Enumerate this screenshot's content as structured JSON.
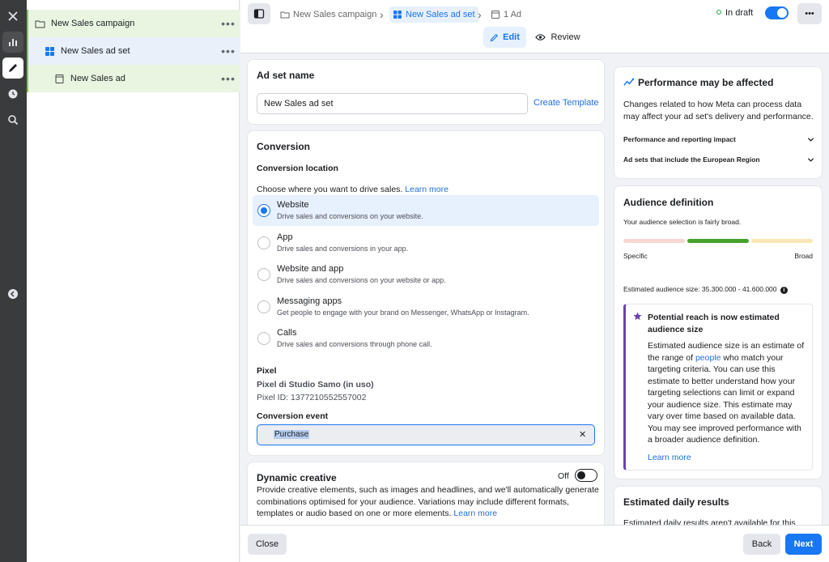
{
  "tree": {
    "campaign": "New Sales campaign",
    "adset": "New Sales ad set",
    "ad": "New Sales ad",
    "more": "•••"
  },
  "breadcrumb": {
    "campaign": "New Sales campaign",
    "adset": "New Sales ad set",
    "ad": "1 Ad",
    "separator": "›"
  },
  "header": {
    "status": "In draft",
    "more": "•••",
    "edit": "Edit",
    "review": "Review",
    "toggle_on": true
  },
  "adset_name": {
    "title": "Ad set name",
    "value": "New Sales ad set",
    "create_template": "Create Template"
  },
  "conversion": {
    "title": "Conversion",
    "location_label": "Conversion location",
    "prompt": "Choose where you want to drive sales.",
    "learn_more": "Learn more",
    "options": [
      {
        "title": "Website",
        "desc": "Drive sales and conversions on your website.",
        "selected": true
      },
      {
        "title": "App",
        "desc": "Drive sales and conversions in your app.",
        "selected": false
      },
      {
        "title": "Website and app",
        "desc": "Drive sales and conversions on your website or app.",
        "selected": false
      },
      {
        "title": "Messaging apps",
        "desc": "Get people to engage with your brand on Messenger, WhatsApp or Instagram.",
        "selected": false
      },
      {
        "title": "Calls",
        "desc": "Drive sales and conversions through phone call.",
        "selected": false
      }
    ],
    "pixel_label": "Pixel",
    "pixel_name": "Pixel di Studio Samo (in uso)",
    "pixel_id": "Pixel ID: 1377210552557002",
    "event_label": "Conversion event",
    "event_value": "Purchase",
    "clear": "✕"
  },
  "dynamic": {
    "title": "Dynamic creative",
    "toggle": "Off",
    "desc": "Provide creative elements, such as images and headlines, and we'll automatically generate combinations optimised for your audience. Variations may include different formats, templates or audio based on one or more elements.",
    "learn_more": "Learn more"
  },
  "performance": {
    "title": "Performance may be affected",
    "desc": "Changes related to how Meta can process data may affect your ad set's delivery and performance.",
    "row1": "Performance and reporting impact",
    "row2": "Ad sets that include the European Region"
  },
  "audience": {
    "title": "Audience definition",
    "desc": "Your audience selection is fairly broad.",
    "specific": "Specific",
    "broad": "Broad",
    "estimate": "Estimated audience size: 35.300.000 - 41.600.000",
    "info": "i",
    "reach_title": "Potential reach is now estimated audience size",
    "reach_body_1": "Estimated audience size is an estimate of the range of",
    "reach_people": "people",
    "reach_body_2": "who match your targeting criteria. You can use this estimate to better understand how your targeting selections can limit or expand your audience size. This estimate may vary over time based on available data. You may see improved performance with a broader audience definition.",
    "learn_more": "Learn more"
  },
  "daily": {
    "title": "Estimated daily results",
    "desc": "Estimated daily results aren't available for this"
  },
  "footer": {
    "close": "Close",
    "back": "Back",
    "next": "Next"
  },
  "colors": {
    "accent": "#1877f2",
    "tree_highlight": "#eaf5e1",
    "tree_selected": "#e9f0fa",
    "purple": "#6a3fb5"
  }
}
